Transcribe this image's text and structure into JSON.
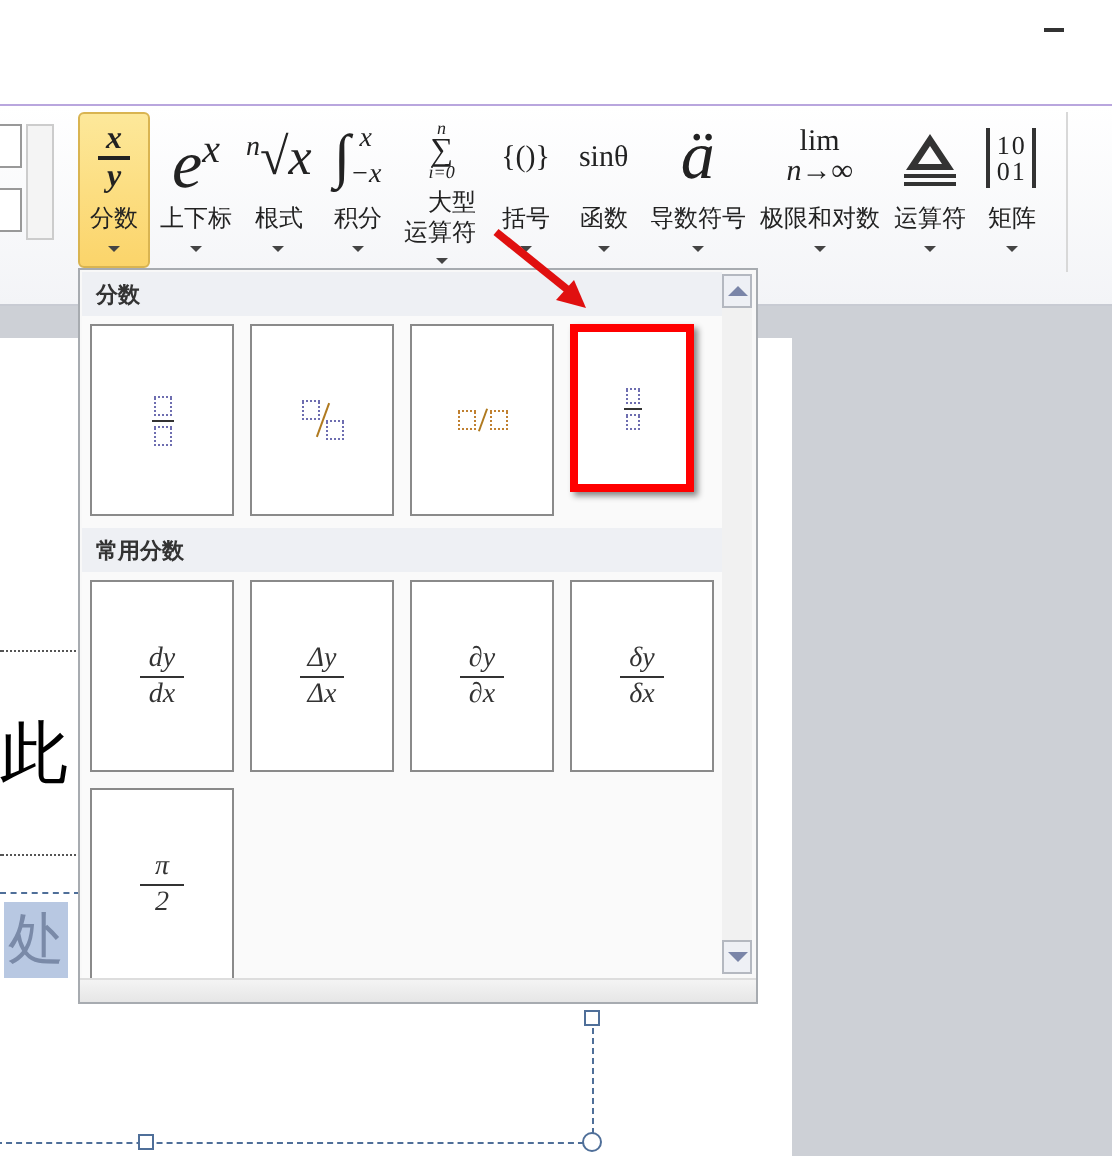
{
  "ribbon": {
    "buttons": [
      {
        "label": "分数",
        "kind": "fraction",
        "num": "x",
        "den": "y",
        "selected": true
      },
      {
        "label": "上下标",
        "kind": "script",
        "base": "e",
        "sup": "x",
        "selected": false
      },
      {
        "label": "根式",
        "kind": "radical",
        "index": "n",
        "sign": "√",
        "radicand": "x",
        "selected": false
      },
      {
        "label": "积分",
        "kind": "integral",
        "sign": "∫",
        "upper": "x",
        "lower": "−x",
        "selected": false
      },
      {
        "label": "大型运算符",
        "kind": "largeop",
        "upper": "n",
        "sign": "∑",
        "lower": "i=0",
        "selected": false
      },
      {
        "label": "括号",
        "kind": "text",
        "symbol": "{()}",
        "selected": false
      },
      {
        "label": "函数",
        "kind": "text",
        "symbol": "sinθ",
        "selected": false
      },
      {
        "label": "导数符号",
        "kind": "big",
        "symbol": "ä",
        "selected": false
      },
      {
        "label": "极限和对数",
        "kind": "limit",
        "upper": "lim",
        "lower": "n→∞",
        "selected": false
      },
      {
        "label": "运算符",
        "kind": "operator",
        "selected": false
      },
      {
        "label": "矩阵",
        "kind": "matrix",
        "rows": [
          "10",
          "01"
        ],
        "selected": false
      }
    ]
  },
  "gallery": {
    "sections": [
      {
        "title": "分数",
        "items": [
          {
            "kind": "stacked",
            "highlighted": false
          },
          {
            "kind": "skewed",
            "highlighted": false
          },
          {
            "kind": "linear",
            "highlighted": false
          },
          {
            "kind": "small",
            "highlighted": true
          }
        ]
      },
      {
        "title": "常用分数",
        "items": [
          {
            "kind": "common",
            "num": "dy",
            "den": "dx",
            "highlighted": false
          },
          {
            "kind": "common",
            "num": "Δy",
            "den": "Δx",
            "highlighted": false
          },
          {
            "kind": "common",
            "num": "∂y",
            "den": "∂x",
            "highlighted": false
          },
          {
            "kind": "common",
            "num": "δy",
            "den": "δx",
            "highlighted": false
          },
          {
            "kind": "common",
            "num": "π",
            "den": "2",
            "highlighted": false
          }
        ]
      }
    ]
  },
  "document": {
    "line": "此",
    "selected_text": "处"
  }
}
